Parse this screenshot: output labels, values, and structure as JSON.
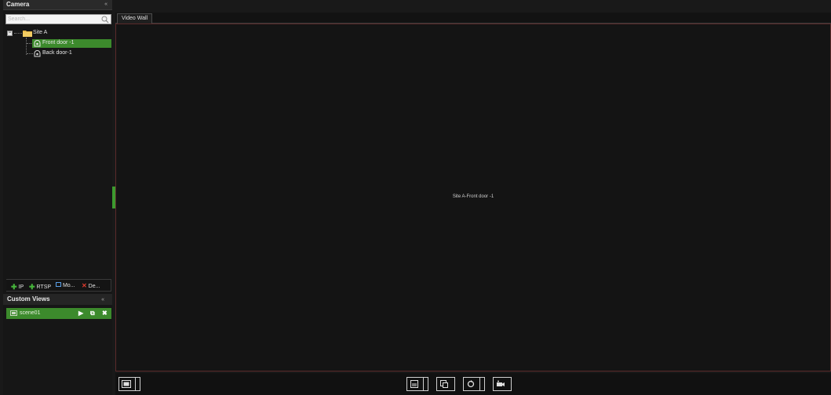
{
  "camera_panel": {
    "title": "Camera",
    "collapse_glyph": "«",
    "search_placeholder": "Search...",
    "site": {
      "name": "Site A",
      "expander": "−"
    },
    "cameras": [
      {
        "label": "Front door -1",
        "selected": true
      },
      {
        "label": "Back door-1",
        "selected": false
      }
    ],
    "toolbar": {
      "add_ip": "IP",
      "add_rtsp": "RTSP",
      "modify": "Mo...",
      "delete": "De..."
    }
  },
  "custom_views": {
    "title": "Custom Views",
    "collapse_glyph": "«",
    "scenes": [
      {
        "label": "scene01",
        "play": "▶",
        "export": "⧉",
        "remove": "✖"
      }
    ]
  },
  "video_wall": {
    "tab_label": "Video Wall",
    "tile_caption": "Site A-Front door -1"
  },
  "bottom_toolbar": {
    "icons": [
      "layout-single-icon",
      "save-layout-icon",
      "copy-view-icon",
      "refresh-icon",
      "camera-capture-icon"
    ]
  },
  "colors": {
    "selection_green": "#3c8a2c",
    "splitter_green": "#3d9a2f",
    "add_green": "#45b33a",
    "delete_red": "#e03a2e"
  }
}
